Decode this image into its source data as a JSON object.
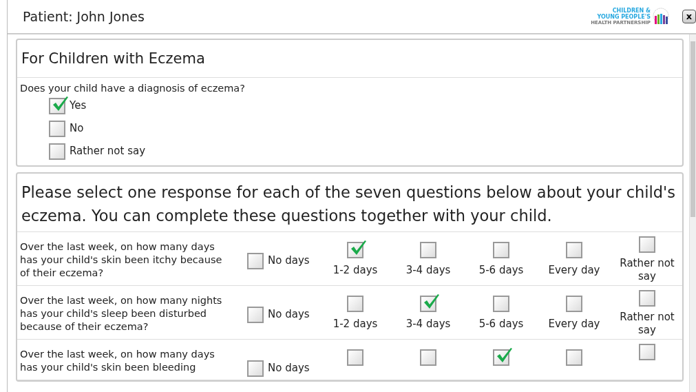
{
  "header": {
    "title": "Patient: John Jones",
    "logo_lines": [
      "CHILDREN &",
      "YOUNG PEOPLE'S",
      "HEALTH PARTNERSHIP"
    ],
    "close_label": "x"
  },
  "diagnosis": {
    "heading": "For Children with Eczema",
    "question": "Does your child have a diagnosis of eczema?",
    "options": [
      {
        "label": "Yes",
        "checked": true
      },
      {
        "label": "No",
        "checked": false
      },
      {
        "label": "Rather not say",
        "checked": false
      }
    ]
  },
  "questionnaire": {
    "intro": "Please select one response for each of the seven questions below about your child's eczema. You can complete these questions together with your child.",
    "questions": [
      {
        "text": "Over the last week, on how many days has your child's skin been itchy because of their eczema?",
        "options": [
          {
            "kind": "inline",
            "label": "No days",
            "checked": false
          },
          {
            "kind": "stacked",
            "label": "1-2 days",
            "checked": true
          },
          {
            "kind": "stacked",
            "label": "3-4 days",
            "checked": false
          },
          {
            "kind": "stacked",
            "label": "5-6 days",
            "checked": false
          },
          {
            "kind": "stacked",
            "label": "Every day",
            "checked": false
          },
          {
            "kind": "stacked",
            "label": "Rather not say",
            "checked": false
          }
        ]
      },
      {
        "text": "Over the last week, on how many nights has your child's sleep been disturbed because of their eczema?",
        "options": [
          {
            "kind": "inline",
            "label": "No days",
            "checked": false
          },
          {
            "kind": "stacked",
            "label": "1-2 days",
            "checked": false
          },
          {
            "kind": "stacked",
            "label": "3-4 days",
            "checked": true
          },
          {
            "kind": "stacked",
            "label": "5-6 days",
            "checked": false
          },
          {
            "kind": "stacked",
            "label": "Every day",
            "checked": false
          },
          {
            "kind": "stacked",
            "label": "Rather not say",
            "checked": false
          }
        ]
      },
      {
        "text": "Over the last week, on how many days has your child's skin been bleeding",
        "options": [
          {
            "kind": "inline",
            "label": "No days",
            "checked": false
          },
          {
            "kind": "stacked",
            "checked": false
          },
          {
            "kind": "stacked",
            "checked": false
          },
          {
            "kind": "stacked",
            "checked": true
          },
          {
            "kind": "stacked",
            "checked": false
          },
          {
            "kind": "stacked",
            "checked": false
          }
        ]
      }
    ]
  }
}
